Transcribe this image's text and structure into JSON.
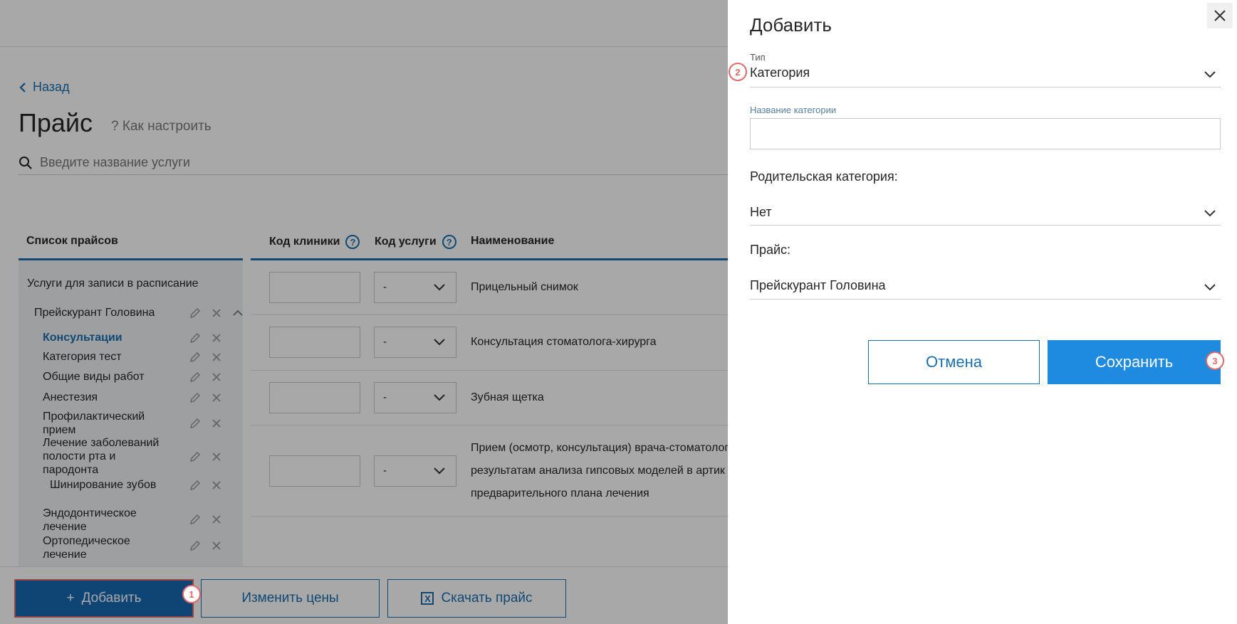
{
  "page": {
    "back_label": "Назад",
    "title": "Прайс",
    "howto_label": "? Как настроить",
    "search_placeholder": "Введите название услуги"
  },
  "price_list": {
    "header": "Список прайсов",
    "group_label": "Услуги для записи в расписание",
    "price_name": "Прейскурант Головина",
    "items": [
      {
        "label": "Консультации",
        "active": true
      },
      {
        "label": "Категория тест"
      },
      {
        "label": "Общие виды работ"
      },
      {
        "label": "Анестезия"
      },
      {
        "label": "Профилактический прием"
      },
      {
        "label": "Лечение заболеваний полости рта и пародонта"
      },
      {
        "label": "Шинирование зубов"
      },
      {
        "label": "Эндодонтическое лечение"
      },
      {
        "label": "Ортопедическое лечение"
      }
    ]
  },
  "table": {
    "columns": [
      "Код клиники",
      "Код услуги",
      "Наименование"
    ],
    "rows": [
      {
        "code_select": "-",
        "name": "Прицельный снимок"
      },
      {
        "code_select": "-",
        "name": "Консультация стоматолога-хирурга"
      },
      {
        "code_select": "-",
        "name": "Зубная щетка"
      },
      {
        "code_select": "-",
        "name": "Прием (осмотр, консультация) врача-стоматолог",
        "name2": "результатам анализа гипсовых моделей в артик",
        "name3": "предварительного плана лечения"
      }
    ]
  },
  "bottom_bar": {
    "add_label": "Добавить",
    "change_prices_label": "Изменить цены",
    "download_label": "Скачать прайс"
  },
  "drawer": {
    "title": "Добавить",
    "type_label": "Тип",
    "type_value": "Категория",
    "category_name_label": "Название категории",
    "category_name_value": "",
    "parent_label": "Родительская категория:",
    "parent_value": "Нет",
    "price_label": "Прайс:",
    "price_value": "Прейскурант Головина",
    "cancel_label": "Отмена",
    "save_label": "Сохранить"
  },
  "badges": [
    "1",
    "2",
    "3"
  ],
  "colors": {
    "accent": "#1b6fb0",
    "save_button": "#1e8be0",
    "highlight": "#e06a6a"
  }
}
